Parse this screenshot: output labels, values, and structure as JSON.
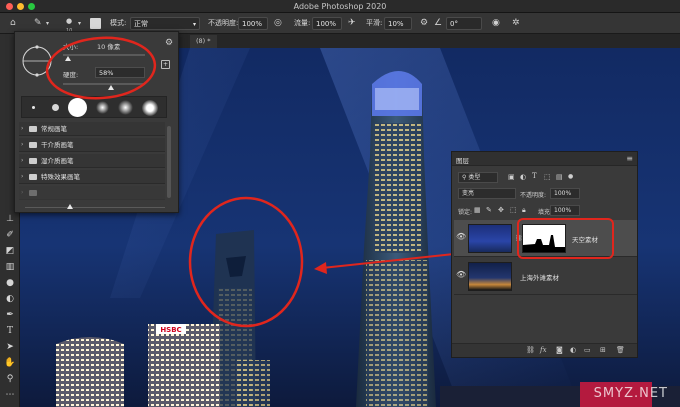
{
  "window": {
    "title": "Adobe Photoshop 2020",
    "traffic_colors": [
      "#fe5f57",
      "#febc2e",
      "#28c840"
    ]
  },
  "options_bar": {
    "brush_size": "10",
    "mode_label": "模式:",
    "mode_value": "正常",
    "opacity_label": "不透明度:",
    "opacity_value": "100%",
    "flow_label": "流量:",
    "flow_value": "100%",
    "smoothing_label": "平滑:",
    "smoothing_value": "10%",
    "angle_value": "0°"
  },
  "document_tab": {
    "label": "(8) *"
  },
  "brush_picker": {
    "size_label": "大小:",
    "size_value": "10 像素",
    "hardness_label": "硬度:",
    "hardness_value": "58%",
    "hardness_fraction": 0.58,
    "folders": [
      {
        "label": "常规画笔"
      },
      {
        "label": "干介质画笔"
      },
      {
        "label": "湿介质画笔"
      },
      {
        "label": "特殊效果画笔"
      }
    ]
  },
  "layers_panel": {
    "tab_label": "图层",
    "kind_filter": "类型",
    "blend_mode": "变亮",
    "opacity_label": "不透明度:",
    "opacity_value": "100%",
    "lock_label": "锁定:",
    "fill_label": "填充:",
    "fill_value": "100%",
    "layers": [
      {
        "name": "天空素材",
        "visible": true,
        "selected": true,
        "has_mask": true
      },
      {
        "name": "上海外滩素材",
        "visible": true,
        "selected": false,
        "has_mask": false
      }
    ],
    "footer_icons": [
      "link-icon",
      "fx-icon",
      "mask-icon",
      "adjustment-icon",
      "group-icon",
      "new-layer-icon",
      "trash-icon"
    ]
  },
  "canvas": {
    "hsbc_sign": "HSBC",
    "watermark": "SMYZ.NET",
    "annotation_color": "#e0261d"
  }
}
